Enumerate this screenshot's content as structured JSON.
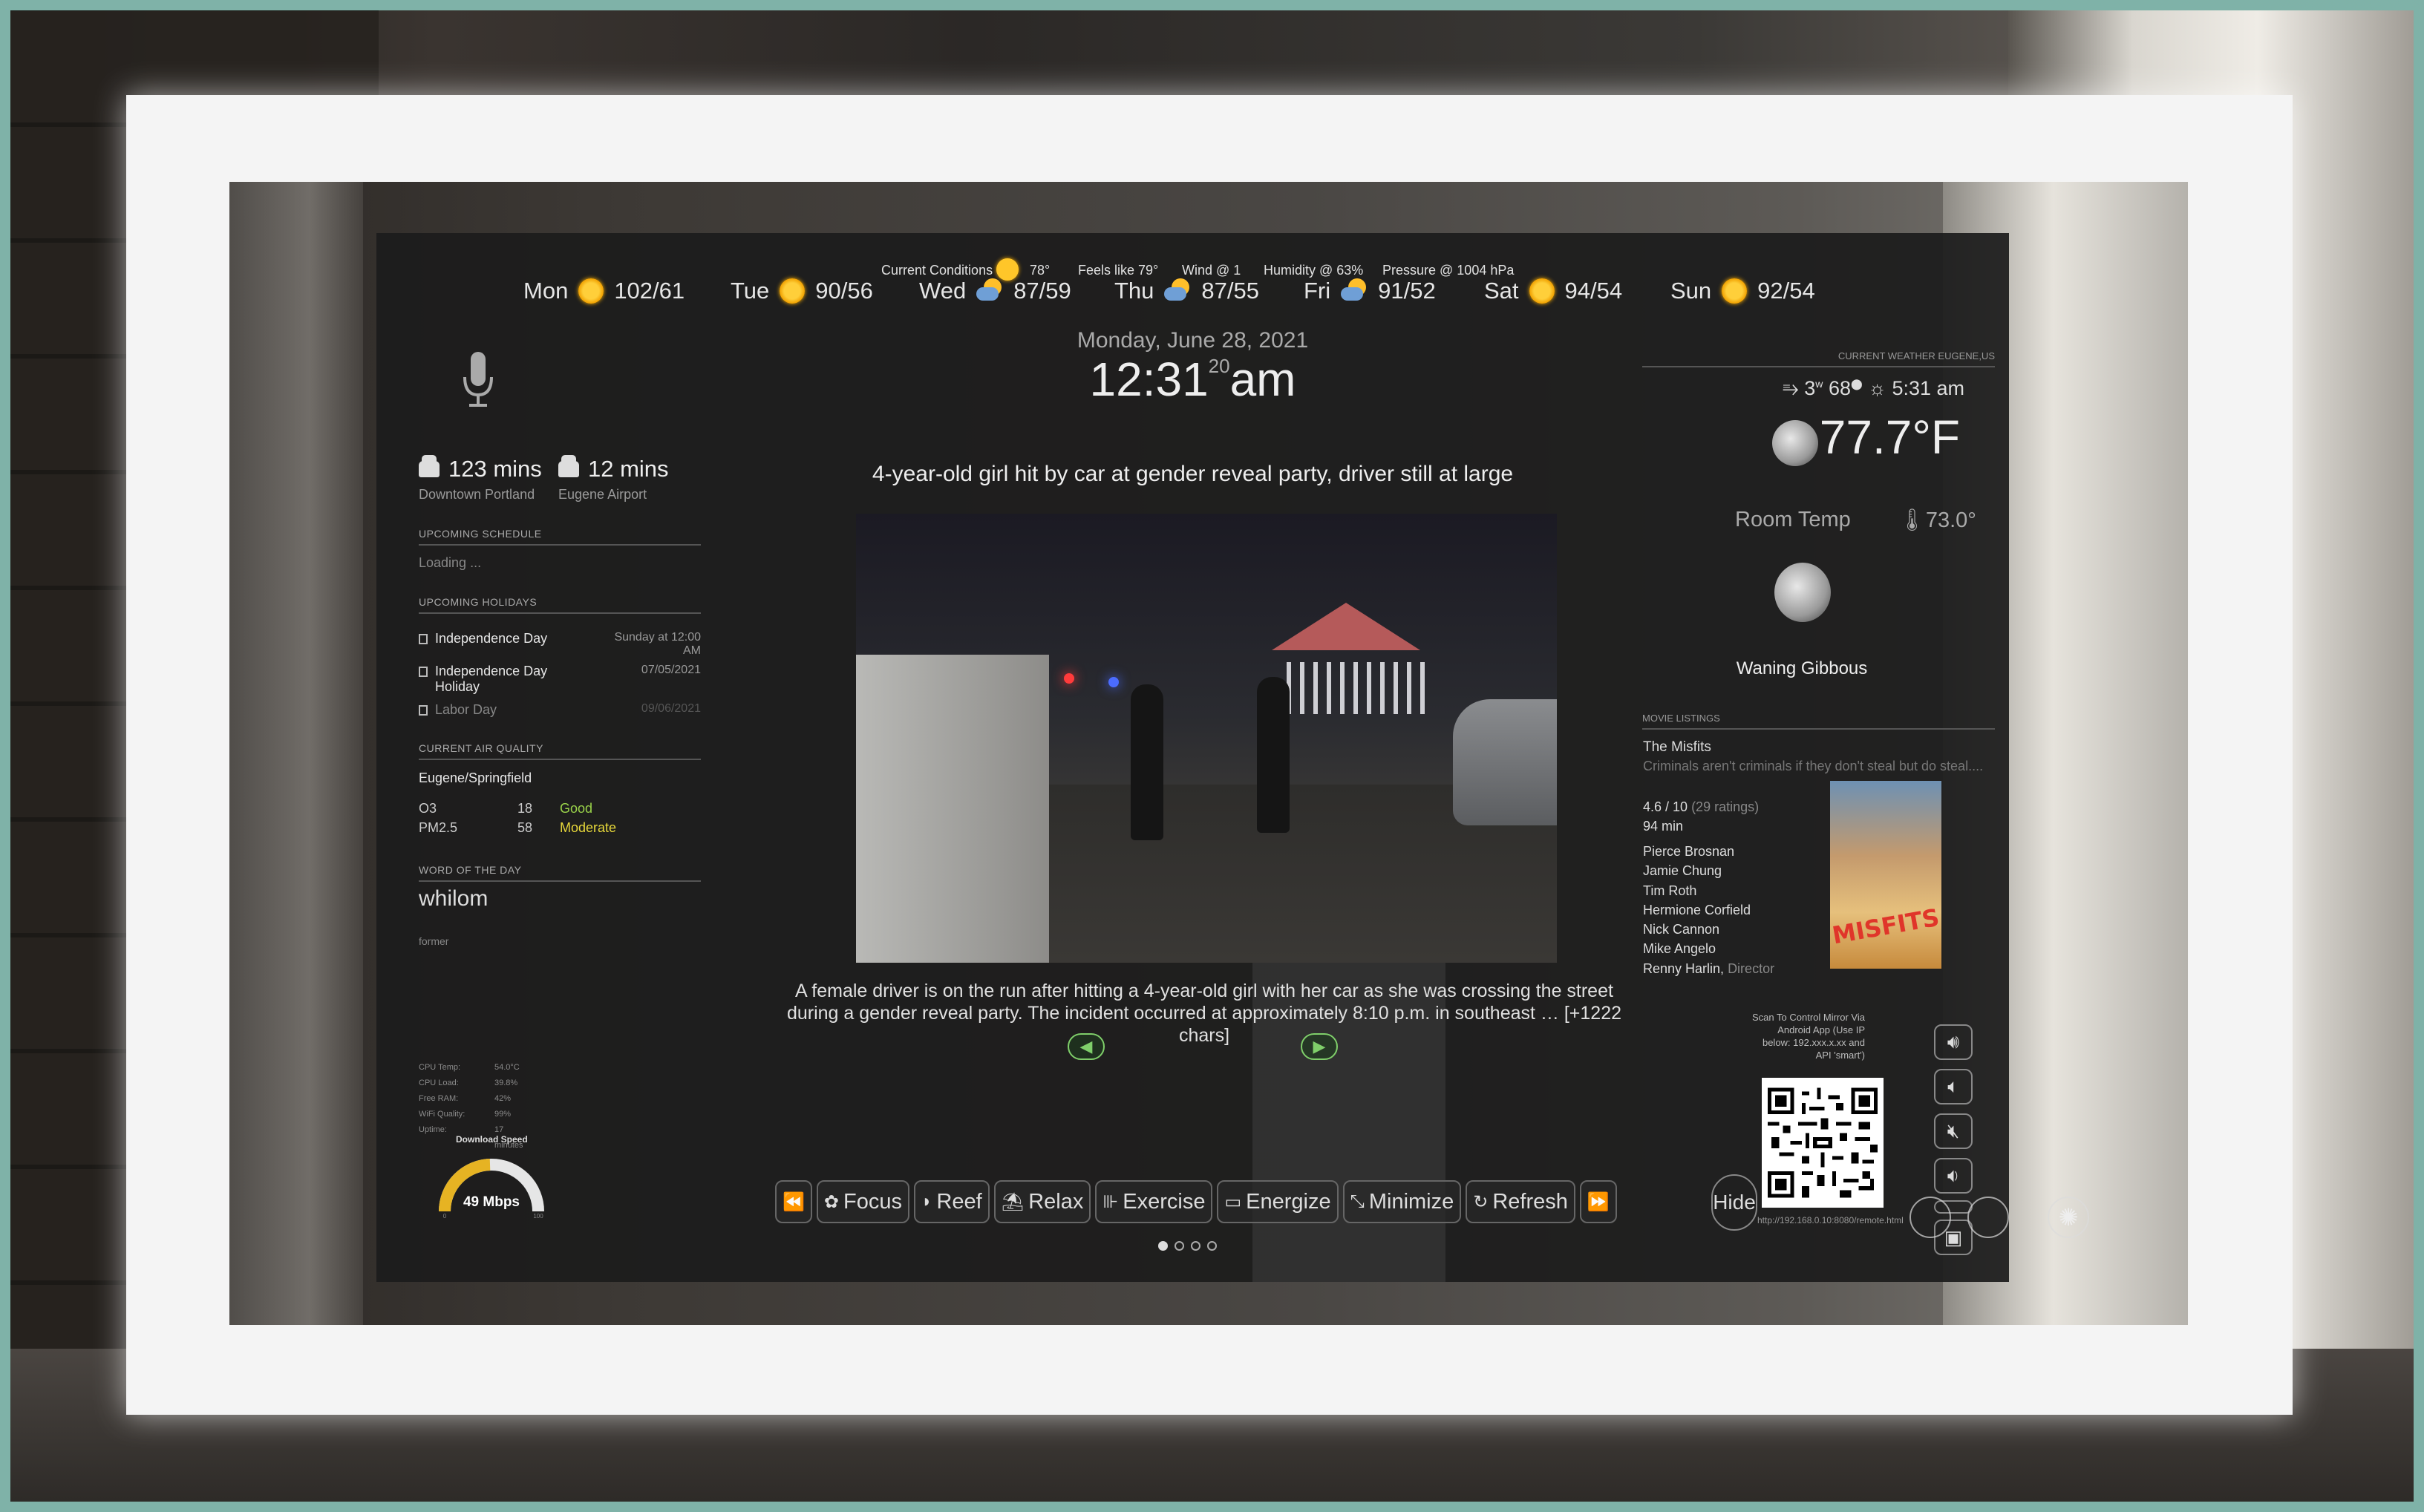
{
  "forecast": [
    {
      "day": "Mon",
      "temps": "102/61",
      "icon": "sun-icon"
    },
    {
      "day": "Tue",
      "temps": "90/56",
      "icon": "sun-icon"
    },
    {
      "day": "Wed",
      "temps": "87/59",
      "icon": "partly-cloudy-icon"
    },
    {
      "day": "Thu",
      "temps": "87/55",
      "icon": "partly-cloudy-icon"
    },
    {
      "day": "Fri",
      "temps": "91/52",
      "icon": "partly-cloudy-icon"
    },
    {
      "day": "Sat",
      "temps": "94/54",
      "icon": "sun-icon"
    },
    {
      "day": "Sun",
      "temps": "92/54",
      "icon": "sun-icon"
    }
  ],
  "conditions": {
    "current": "Current Conditions",
    "current_temp": "78°",
    "feels_like": "Feels like 79°",
    "wind": "Wind @ 1",
    "humidity": "Humidity @ 63%",
    "pressure": "Pressure @ 1004 hPa"
  },
  "travel": [
    {
      "time": "123 mins",
      "dest": "Downtown Portland"
    },
    {
      "time": "12 mins",
      "dest": "Eugene Airport"
    }
  ],
  "schedule": {
    "header": "UPCOMING SCHEDULE",
    "status": "Loading ..."
  },
  "holidays": {
    "header": "UPCOMING HOLIDAYS",
    "items": [
      {
        "name": "Independence Day",
        "when": "Sunday at 12:00 AM"
      },
      {
        "name": "Independence Day Holiday",
        "when": "07/05/2021"
      },
      {
        "name": "Labor Day",
        "when": "09/06/2021"
      }
    ]
  },
  "air_quality": {
    "header": "CURRENT AIR QUALITY",
    "location": "Eugene/Springfield",
    "rows": [
      {
        "pollutant": "O3",
        "value": "18",
        "status": "Good",
        "color": "#9ad34a"
      },
      {
        "pollutant": "PM2.5",
        "value": "58",
        "status": "Moderate",
        "color": "#e7d83a"
      }
    ]
  },
  "word_of_day": {
    "header": "WORD OF THE DAY",
    "word": "whilom",
    "definition": "former"
  },
  "system": {
    "rows": [
      {
        "label": "CPU Temp:",
        "value": "54.0°C"
      },
      {
        "label": "CPU Load:",
        "value": "39.8%"
      },
      {
        "label": "Free RAM:",
        "value": "42%"
      },
      {
        "label": "WiFi Quality:",
        "value": "99%"
      },
      {
        "label": "Uptime:",
        "value": "17 minutes"
      }
    ],
    "speed_title": "Download Speed",
    "speed": "49 Mbps",
    "speed_fraction": 0.49,
    "gauge_min": "0",
    "gauge_max": "100"
  },
  "clock": {
    "date": "Monday, June 28, 2021",
    "time": "12:31",
    "seconds": "20",
    "ampm": "am"
  },
  "news": {
    "headline": "4-year-old girl hit by car at gender reveal party, driver still at large",
    "description": "A female driver is on the run after hitting a 4-year-old girl with her car as she was crossing the street during a gender reveal party. The incident occurred at approximately 8:10 p.m. in southeast … [+1222 chars]",
    "prev_icon": "arrow-left-icon",
    "next_icon": "arrow-right-icon"
  },
  "toolbar": [
    {
      "label": "",
      "icon": "⏪",
      "name": "rewind-button"
    },
    {
      "label": "Focus",
      "icon": "✿",
      "name": "focus-button"
    },
    {
      "label": "Reef",
      "icon": "◗",
      "name": "reef-button"
    },
    {
      "label": "Relax",
      "icon": "⛱",
      "name": "relax-button"
    },
    {
      "label": "Exercise",
      "icon": "⊪",
      "name": "exercise-button"
    },
    {
      "label": "Energize",
      "icon": "▭",
      "name": "energize-button"
    },
    {
      "label": "Minimize",
      "icon": "⤡",
      "name": "minimize-button"
    },
    {
      "label": "Refresh",
      "icon": "↻",
      "name": "refresh-button"
    },
    {
      "label": "",
      "icon": "⏩",
      "name": "fast-forward-button"
    }
  ],
  "weather": {
    "header": "CURRENT WEATHER EUGENE,US",
    "wind": "3",
    "wind_dir": "68",
    "sunrise": "5:31 am",
    "temp": "77.7°F",
    "room_label": "Room Temp",
    "room_temp": "73.0°",
    "moon_phase": "Waning Gibbous"
  },
  "movie": {
    "header": "MOVIE LISTINGS",
    "title": "The Misfits",
    "tagline": "Criminals aren't criminals if they don't steal but do steal....",
    "rating": "4.6 / 10",
    "ratings_count": "(29 ratings)",
    "runtime": "94 min",
    "cast": [
      "Pierce Brosnan",
      "Jamie Chung",
      "Tim Roth",
      "Hermione Corfield",
      "Nick Cannon",
      "Mike Angelo",
      "Renny Harlin,"
    ],
    "director_label": "Director",
    "poster_text": "MISFITS"
  },
  "remote": {
    "note": "Scan To Control Mirror Via Android App (Use IP below: 192.xxx.x.xx and API 'smart')",
    "url": "http://192.168.0.10:8080/remote.html",
    "hide_label": "Hide"
  }
}
